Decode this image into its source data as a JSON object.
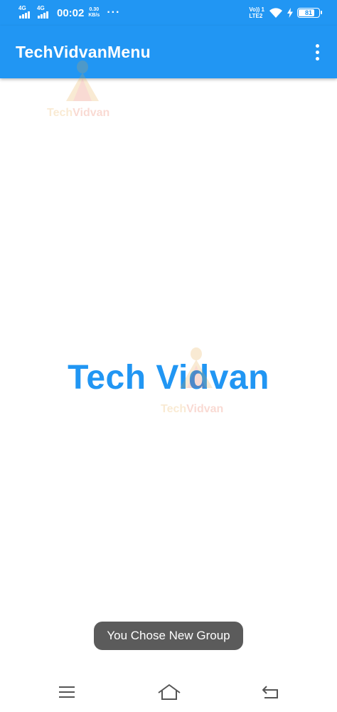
{
  "status_bar": {
    "sim1_label": "4G",
    "sim2_label": "4G",
    "time": "00:02",
    "speed_value": "0.30",
    "speed_unit": "KB/s",
    "more": "···",
    "volte_top": "Vo)) 1",
    "volte_bottom": "LTE2",
    "battery_level": "81",
    "battery_fraction": 0.81
  },
  "app_bar": {
    "title": "TechVidvanMenu",
    "overflow_icon": "more-vert-icon"
  },
  "watermark": {
    "text_part1": "Tech",
    "text_part2": "Vidvan",
    "colors": {
      "primary": "#E8A43A",
      "accent": "#E85A3A"
    }
  },
  "content": {
    "main_text": "Tech Vidvan"
  },
  "toast": {
    "message": "You Chose New Group"
  },
  "nav_bar": {
    "menu_icon": "menu-icon",
    "home_icon": "home-icon",
    "back_icon": "back-icon"
  },
  "colors": {
    "primary": "#2196F3",
    "toast_bg": "#5b5b5b",
    "background": "#ffffff"
  }
}
